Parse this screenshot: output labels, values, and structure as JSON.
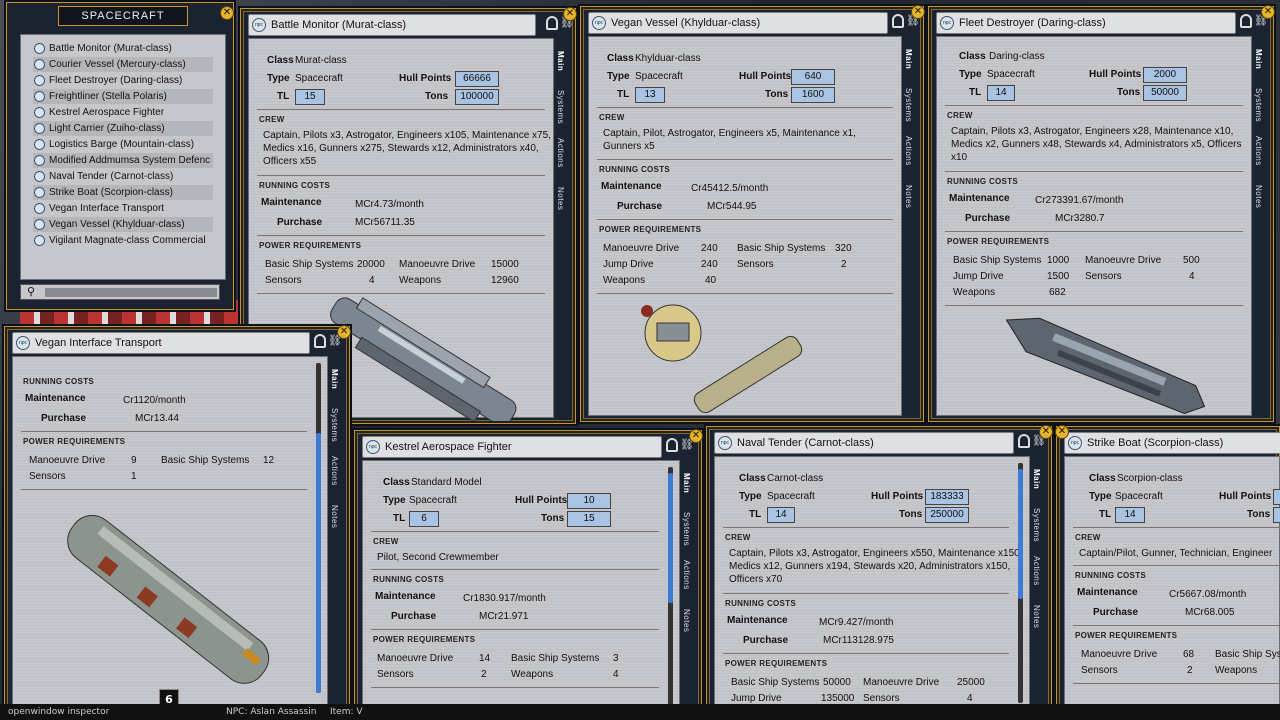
{
  "spacecraft_list": {
    "header": "SPACECRAFT",
    "items": [
      "Battle Monitor (Murat-class)",
      "Courier Vessel (Mercury-class)",
      "Fleet Destroyer (Daring-class)",
      "Freightliner (Stella Polaris)",
      "Kestrel Aerospace Fighter",
      "Light Carrier (Zuiho-class)",
      "Logistics Barge (Mountain-class)",
      "Modified Addmumsa System Defenc",
      "Naval Tender (Carnot-class)",
      "Strike Boat (Scorpion-class)",
      "Vegan Interface Transport",
      "Vegan Vessel (Khylduar-class)",
      "Vigilant Magnate-class Commercial"
    ]
  },
  "tabs": {
    "main": "Main",
    "systems": "Systems",
    "actions": "Actions",
    "notes": "Notes"
  },
  "labels": {
    "class": "Class",
    "type": "Type",
    "tl": "TL",
    "hull": "Hull Points",
    "tons": "Tons",
    "crew": "CREW",
    "running": "RUNNING COSTS",
    "maint": "Maintenance",
    "purchase": "Purchase",
    "power": "POWER REQUIREMENTS",
    "bss": "Basic Ship Systems",
    "md": "Manoeuvre Drive",
    "jd": "Jump Drive",
    "sensors": "Sensors",
    "weapons": "Weapons"
  },
  "battle_monitor": {
    "title": "Battle Monitor (Murat-class)",
    "class": "Murat-class",
    "type": "Spacecraft",
    "tl": "15",
    "hull": "66666",
    "tons": "100000",
    "crew": "Captain, Pilots x3, Astrogator, Engineers x105, Maintenance x75, Medics x16, Gunners x275, Stewards x12, Administrators x40, Officers x55",
    "maint": "MCr4.73/month",
    "purchase": "MCr56711.35",
    "bss": "20000",
    "md": "15000",
    "sensors": "4",
    "weapons": "12960"
  },
  "vegan_vessel": {
    "title": "Vegan Vessel (Khylduar-class)",
    "class": "Khylduar-class",
    "type": "Spacecraft",
    "tl": "13",
    "hull": "640",
    "tons": "1600",
    "crew": "Captain, Pilot, Astrogator, Engineers x5, Maintenance x1, Gunners x5",
    "maint": "Cr45412.5/month",
    "purchase": "MCr544.95",
    "md": "240",
    "bss": "320",
    "jd": "240",
    "sensors": "2",
    "weapons": "40"
  },
  "fleet_destroyer": {
    "title": "Fleet Destroyer (Daring-class)",
    "class": "Daring-class",
    "type": "Spacecraft",
    "tl": "14",
    "hull": "2000",
    "tons": "50000",
    "crew": "Captain, Pilots x3, Astrogator, Engineers x28, Maintenance x10, Medics x2, Gunners x48, Stewards x4, Administrators x5, Officers x10",
    "maint": "Cr273391.67/month",
    "purchase": "MCr3280.7",
    "bss": "1000",
    "md": "500",
    "jd": "1500",
    "sensors": "4",
    "weapons": "682"
  },
  "vegan_transport": {
    "title": "Vegan Interface Transport",
    "maint": "Cr1120/month",
    "purchase": "MCr13.44",
    "md": "9",
    "bss": "12",
    "sensors": "1",
    "tag": "6"
  },
  "kestrel": {
    "title": "Kestrel Aerospace Fighter",
    "class": "Standard Model",
    "type": "Spacecraft",
    "tl": "6",
    "hull": "10",
    "tons": "15",
    "crew": "Pilot, Second Crewmember",
    "maint": "Cr1830.917/month",
    "purchase": "MCr21.971",
    "md": "14",
    "bss": "3",
    "sensors": "2",
    "weapons": "4"
  },
  "naval_tender": {
    "title": "Naval Tender (Carnot-class)",
    "class": "Carnot-class",
    "type": "Spacecraft",
    "tl": "14",
    "hull": "183333",
    "tons": "250000",
    "crew": "Captain, Pilots x3, Astrogator, Engineers x550, Maintenance x150, Medics x12, Gunners x194, Stewards x20, Administrators x150, Officers x70",
    "maint": "MCr9.427/month",
    "purchase": "MCr113128.975",
    "bss": "50000",
    "md": "25000",
    "jd": "135000",
    "sensors": "4"
  },
  "strike_boat": {
    "title": "Strike Boat (Scorpion-class)",
    "class": "Scorpion-class",
    "type": "Spacecraft",
    "tl": "14",
    "hull_label": "Hull Points",
    "tons_label": "Tons",
    "crew": "Captain/Pilot, Gunner, Technician, Engineer",
    "maint": "Cr5667.08/month",
    "purchase": "MCr68.005",
    "md": "68",
    "bss": "Basic Ship Syst",
    "sensors": "2",
    "weapons": "Weapons"
  },
  "status_bar": {
    "left": "openwindow inspector",
    "mid": "NPC: Aslan Assassin",
    "right": "Item: V"
  }
}
